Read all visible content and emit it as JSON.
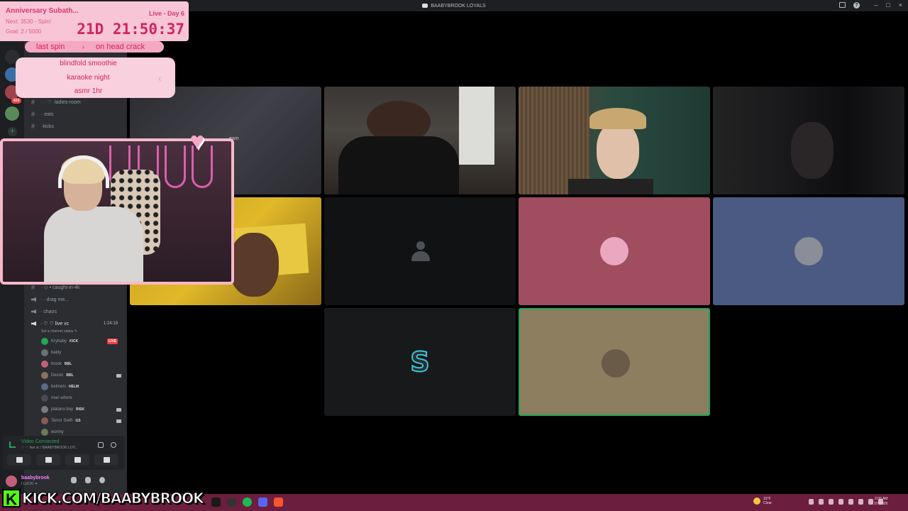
{
  "window": {
    "title": "BAABYBROOK LOYALS"
  },
  "subathon": {
    "title": "Anniversary Subath...",
    "day": "Live - Day 6",
    "next": "Next: 3530 - Spin!",
    "goal": "Goal: 2 / 5000",
    "timer": "21D 21:50:37"
  },
  "spin": {
    "label": "last spin",
    "arrow": "›",
    "value": "on head crack"
  },
  "wheel": {
    "items": [
      "blindfold smoothie",
      "karaoke night",
      "asmr 1hr"
    ],
    "pointer": "‹"
  },
  "rail": {
    "badge": "424"
  },
  "channels": [
    {
      "label": "· · ♡ ·ladies-room",
      "type": "text"
    },
    {
      "label": "·  eats",
      "type": "text"
    },
    {
      "label": "·kicks",
      "type": "text"
    },
    {
      "label": "· ◇ • caught-in-4k",
      "type": "text"
    },
    {
      "label": "· · drag me...",
      "type": "voice"
    },
    {
      "label": "· chaos",
      "type": "voice"
    },
    {
      "label": "· ♡ ♡ live vc",
      "type": "voice"
    }
  ],
  "voice_channel": {
    "timer": "1:24:19",
    "status_hint": "Set a channel status ✎",
    "users": [
      {
        "name": "Krybaby",
        "tag": "KICK",
        "live": "LIVE",
        "color": "#23a559"
      },
      {
        "name": "baldy",
        "tag": "",
        "live": "",
        "color": "#6d6f78"
      },
      {
        "name": "brook",
        "tag": "BBL",
        "live": "",
        "color": "#c1607a"
      },
      {
        "name": "Decon",
        "tag": "BBL",
        "live": "",
        "color": "#8a7060"
      },
      {
        "name": "belmets",
        "tag": "HELM",
        "live": "",
        "color": "#5a6a8a"
      },
      {
        "name": "man whore",
        "tag": "",
        "live": "",
        "color": "#4a4a52"
      },
      {
        "name": "platano boy",
        "tag": "RISK",
        "live": "",
        "color": "#7a7a82"
      },
      {
        "name": "Terror Swift",
        "tag": "GS",
        "live": "",
        "color": "#8a5a5a"
      },
      {
        "name": "wormy",
        "tag": "",
        "live": "",
        "color": "#6a7a5a"
      }
    ]
  },
  "voice_panel": {
    "status": "Video Connected",
    "sub": "♡ ♡ live vc / BAABYBROOK LOY..."
  },
  "user_panel": {
    "name": "baabybrook",
    "sub": "I LUCKI ✦"
  },
  "tiles": {
    "stream_label": "eam"
  },
  "overlay": {
    "kick_letter": "K",
    "kick_url": "KICK.COM/BAABYBROOK"
  },
  "taskbar": {
    "weather_temp": "15°F",
    "weather_cond": "Clear",
    "time": "2:09 AM",
    "date": "2/7/2026"
  },
  "colors": {
    "widget_pink": "#f8c5d7",
    "widget_text": "#d0245e",
    "discord_green": "#23a559",
    "kick_green": "#53fc18",
    "taskbar": "#6b1e3e"
  }
}
